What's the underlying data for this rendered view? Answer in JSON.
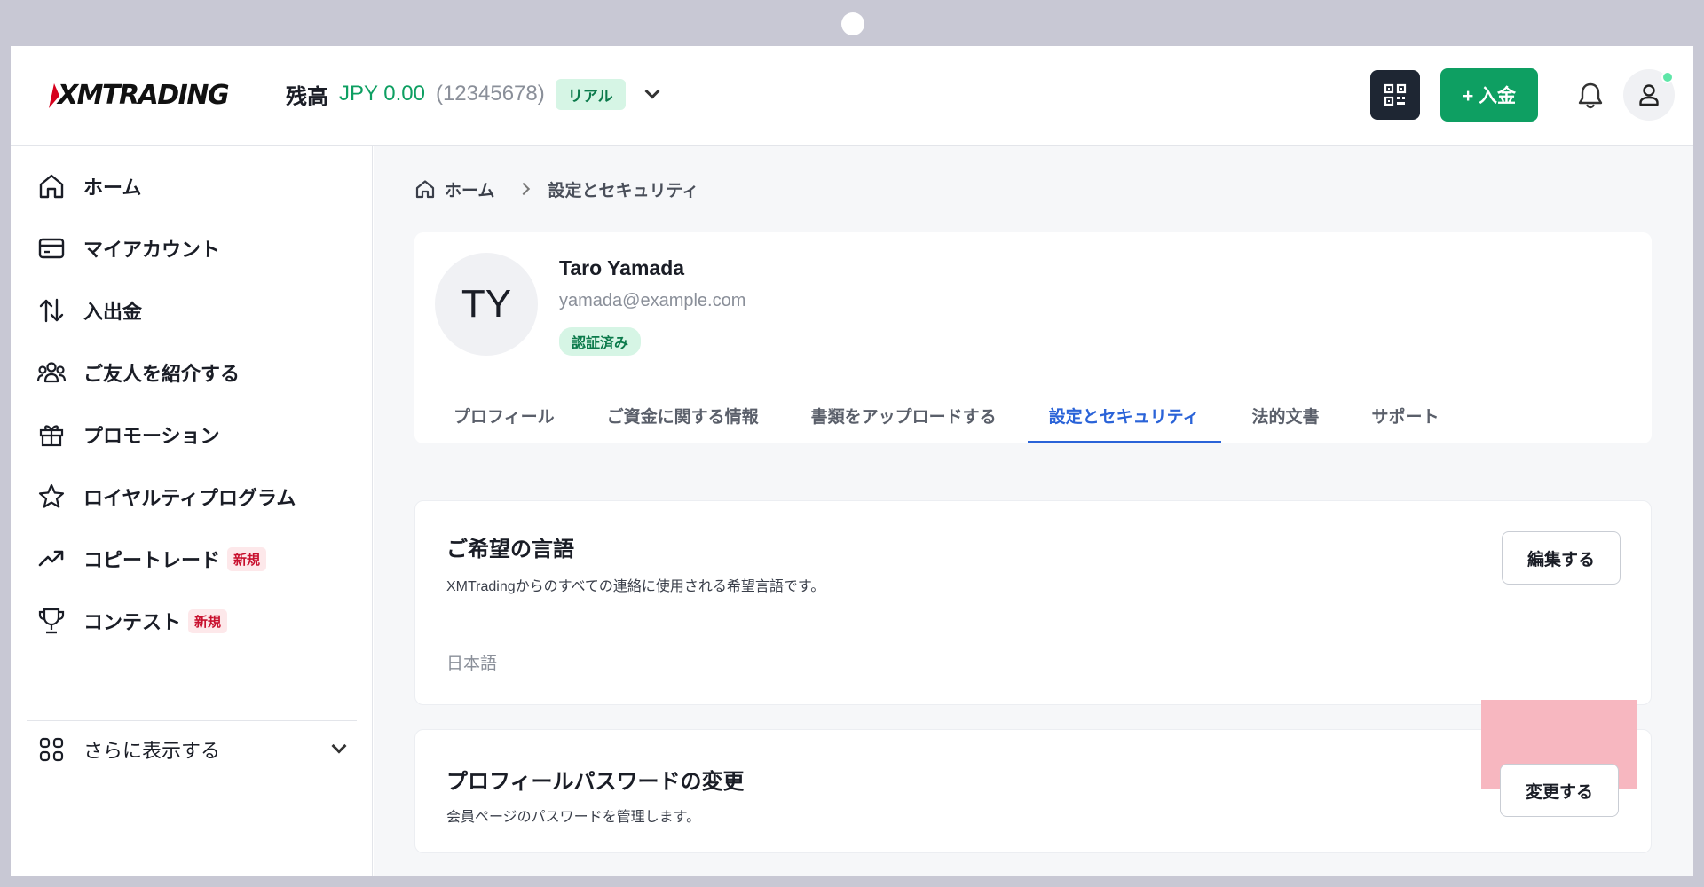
{
  "header": {
    "logo_text": "XMTRADING",
    "balance_label": "残高",
    "balance_value": "JPY 0.00",
    "account_number": "(12345678)",
    "account_type_badge": "リアル",
    "deposit_button": "+ 入金"
  },
  "sidebar": {
    "items": [
      {
        "label": "ホーム",
        "icon": "home-icon"
      },
      {
        "label": "マイアカウント",
        "icon": "card-icon"
      },
      {
        "label": "入出金",
        "icon": "transfer-arrows-icon"
      },
      {
        "label": "ご友人を紹介する",
        "icon": "users-icon"
      },
      {
        "label": "プロモーション",
        "icon": "gift-icon"
      },
      {
        "label": "ロイヤルティプログラム",
        "icon": "star-icon"
      },
      {
        "label": "コピートレード",
        "icon": "trending-up-icon",
        "badge": "新規"
      },
      {
        "label": "コンテスト",
        "icon": "trophy-icon",
        "badge": "新規"
      }
    ],
    "more_label": "さらに表示する"
  },
  "breadcrumb": {
    "home": "ホーム",
    "current": "設定とセキュリティ"
  },
  "profile": {
    "initials": "TY",
    "name": "Taro Yamada",
    "email": "yamada@example.com",
    "status_badge": "認証済み",
    "tabs": [
      {
        "label": "プロフィール",
        "active": false
      },
      {
        "label": "ご資金に関する情報",
        "active": false
      },
      {
        "label": "書類をアップロードする",
        "active": false
      },
      {
        "label": "設定とセキュリティ",
        "active": true
      },
      {
        "label": "法的文書",
        "active": false
      },
      {
        "label": "サポート",
        "active": false
      }
    ]
  },
  "language_section": {
    "title": "ご希望の言語",
    "description": "XMTradingからのすべての連絡に使用される希望言語です。",
    "edit_button": "編集する",
    "value": "日本語"
  },
  "password_section": {
    "title": "プロフィールパスワードの変更",
    "description": "会員ページのパスワードを管理します。",
    "change_button": "変更する"
  },
  "colors": {
    "brand_green": "#0e9f62",
    "active_tab_blue": "#2a63d8",
    "highlight": "#f7b7c0"
  }
}
